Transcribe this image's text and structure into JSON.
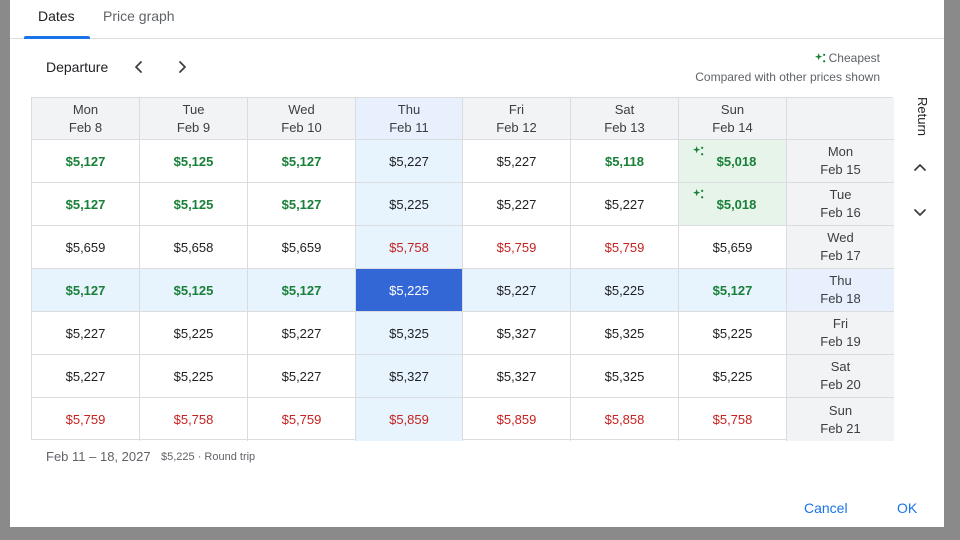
{
  "tabs": [
    {
      "label": "Dates"
    },
    {
      "label": "Price graph"
    }
  ],
  "departure_label": "Departure",
  "legend": {
    "cheapest_label": "Cheapest",
    "note": "Compared with other prices shown"
  },
  "return_label": "Return",
  "departure_days": [
    {
      "dow": "Mon",
      "date": "Feb 8"
    },
    {
      "dow": "Tue",
      "date": "Feb 9"
    },
    {
      "dow": "Wed",
      "date": "Feb 10"
    },
    {
      "dow": "Thu",
      "date": "Feb 11"
    },
    {
      "dow": "Fri",
      "date": "Feb 12"
    },
    {
      "dow": "Sat",
      "date": "Feb 13"
    },
    {
      "dow": "Sun",
      "date": "Feb 14"
    }
  ],
  "return_days": [
    {
      "dow": "Mon",
      "date": "Feb 15"
    },
    {
      "dow": "Tue",
      "date": "Feb 16"
    },
    {
      "dow": "Wed",
      "date": "Feb 17"
    },
    {
      "dow": "Thu",
      "date": "Feb 18"
    },
    {
      "dow": "Fri",
      "date": "Feb 19"
    },
    {
      "dow": "Sat",
      "date": "Feb 20"
    },
    {
      "dow": "Sun",
      "date": "Feb 21"
    }
  ],
  "prices": [
    [
      "$5,127",
      "$5,125",
      "$5,127",
      "$5,227",
      "$5,227",
      "$5,118",
      "$5,018"
    ],
    [
      "$5,127",
      "$5,125",
      "$5,127",
      "$5,225",
      "$5,227",
      "$5,227",
      "$5,018"
    ],
    [
      "$5,659",
      "$5,658",
      "$5,659",
      "$5,758",
      "$5,759",
      "$5,759",
      "$5,659"
    ],
    [
      "$5,127",
      "$5,125",
      "$5,127",
      "$5,225",
      "$5,227",
      "$5,225",
      "$5,127"
    ],
    [
      "$5,227",
      "$5,225",
      "$5,227",
      "$5,325",
      "$5,327",
      "$5,325",
      "$5,225"
    ],
    [
      "$5,227",
      "$5,225",
      "$5,227",
      "$5,327",
      "$5,327",
      "$5,325",
      "$5,225"
    ],
    [
      "$5,759",
      "$5,758",
      "$5,759",
      "$5,859",
      "$5,859",
      "$5,858",
      "$5,758"
    ]
  ],
  "price_levels": [
    [
      "low",
      "low",
      "low",
      "normal",
      "normal",
      "low",
      "cheapest"
    ],
    [
      "low",
      "low",
      "low",
      "normal",
      "normal",
      "normal",
      "cheapest"
    ],
    [
      "normal",
      "normal",
      "normal",
      "high",
      "high",
      "high",
      "normal"
    ],
    [
      "low",
      "low",
      "low",
      "selected",
      "normal",
      "normal",
      "low"
    ],
    [
      "normal",
      "normal",
      "normal",
      "normal",
      "normal",
      "normal",
      "normal"
    ],
    [
      "normal",
      "normal",
      "normal",
      "normal",
      "normal",
      "normal",
      "normal"
    ],
    [
      "high",
      "high",
      "high",
      "high",
      "high",
      "high",
      "high"
    ]
  ],
  "selected": {
    "departure_index": 3,
    "return_index": 3
  },
  "colors": {
    "low": "#188038",
    "high": "#c5221f",
    "selected": "#3367d6",
    "accent": "#1a73e8"
  },
  "summary": {
    "dates": "Feb 11 – 18, 2027",
    "price": "$5,225 · Round trip"
  },
  "buttons": {
    "cancel": "Cancel",
    "ok": "OK"
  },
  "icons": {
    "prev": "chevron-left-icon",
    "next": "chevron-right-icon",
    "up": "chevron-up-icon",
    "down": "chevron-down-icon",
    "cheapest": "sparkle-icon"
  }
}
